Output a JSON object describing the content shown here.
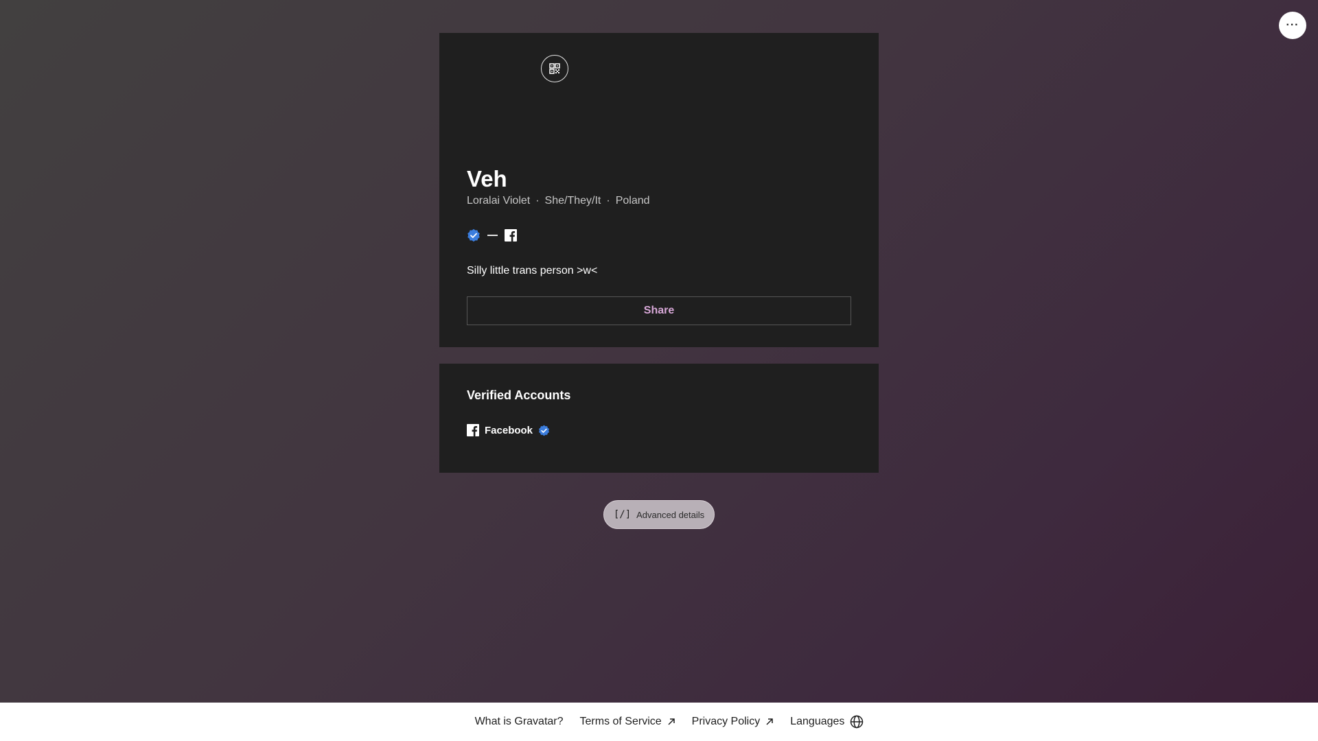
{
  "menu": {
    "label": "···"
  },
  "profile": {
    "display_name": "Veh",
    "full_name": "Loralai Violet",
    "pronouns": "She/They/It",
    "location": "Poland",
    "separator": "·",
    "bio": "Silly little trans person >w<",
    "share_label": "Share"
  },
  "verified": {
    "title": "Verified Accounts",
    "accounts": [
      {
        "label": "Facebook",
        "icon": "facebook-icon"
      }
    ]
  },
  "advanced": {
    "code": "[/]",
    "label": "Advanced details"
  },
  "footer": {
    "what_is": "What is Gravatar?",
    "terms": "Terms of Service",
    "privacy": "Privacy Policy",
    "languages": "Languages"
  },
  "colors": {
    "accent": "#d8a8d8",
    "verified_badge": "#3b7ddd",
    "card_bg": "#1f1f1f"
  }
}
